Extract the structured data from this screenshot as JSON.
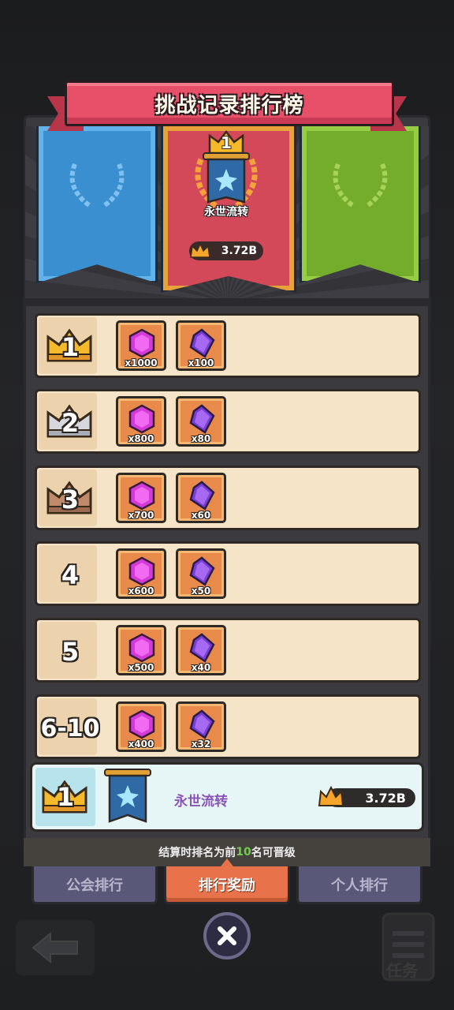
{
  "title": "挑战记录排行榜",
  "podium": {
    "first": {
      "rank": "1",
      "guild_name": "永世流转",
      "score": "3.72B"
    }
  },
  "rewards": [
    {
      "rank": "1",
      "crown": "gold",
      "items": [
        {
          "icon": "pink-gem-icon",
          "qty": "x1000"
        },
        {
          "icon": "purple-crystal-icon",
          "qty": "x100"
        }
      ]
    },
    {
      "rank": "2",
      "crown": "silver",
      "items": [
        {
          "icon": "pink-gem-icon",
          "qty": "x800"
        },
        {
          "icon": "purple-crystal-icon",
          "qty": "x80"
        }
      ]
    },
    {
      "rank": "3",
      "crown": "bronze",
      "items": [
        {
          "icon": "pink-gem-icon",
          "qty": "x700"
        },
        {
          "icon": "purple-crystal-icon",
          "qty": "x60"
        }
      ]
    },
    {
      "rank": "4",
      "crown": "none",
      "items": [
        {
          "icon": "pink-gem-icon",
          "qty": "x600"
        },
        {
          "icon": "purple-crystal-icon",
          "qty": "x50"
        }
      ]
    },
    {
      "rank": "5",
      "crown": "none",
      "items": [
        {
          "icon": "pink-gem-icon",
          "qty": "x500"
        },
        {
          "icon": "purple-crystal-icon",
          "qty": "x40"
        }
      ]
    },
    {
      "rank": "6-10",
      "crown": "none",
      "items": [
        {
          "icon": "pink-gem-icon",
          "qty": "x400"
        },
        {
          "icon": "purple-crystal-icon",
          "qty": "x32"
        }
      ]
    }
  ],
  "my_guild": {
    "rank": "1",
    "name": "永世流转",
    "score": "3.72B"
  },
  "promotion": {
    "before": "结算时排名为前",
    "highlight": "10",
    "after": "名可晋级"
  },
  "tabs": [
    {
      "label": "公会排行",
      "active": false
    },
    {
      "label": "排行奖励",
      "active": true
    },
    {
      "label": "个人排行",
      "active": false
    }
  ],
  "bottom": {
    "task_label": "任务"
  },
  "colors": {
    "ribbon": "#e8506a",
    "row_bg": "#f5e4c8",
    "my_row_bg": "#e6f6f6",
    "active_tab": "#e8734a",
    "inactive_tab": "#5a5878",
    "promo_highlight": "#6cd04a"
  }
}
